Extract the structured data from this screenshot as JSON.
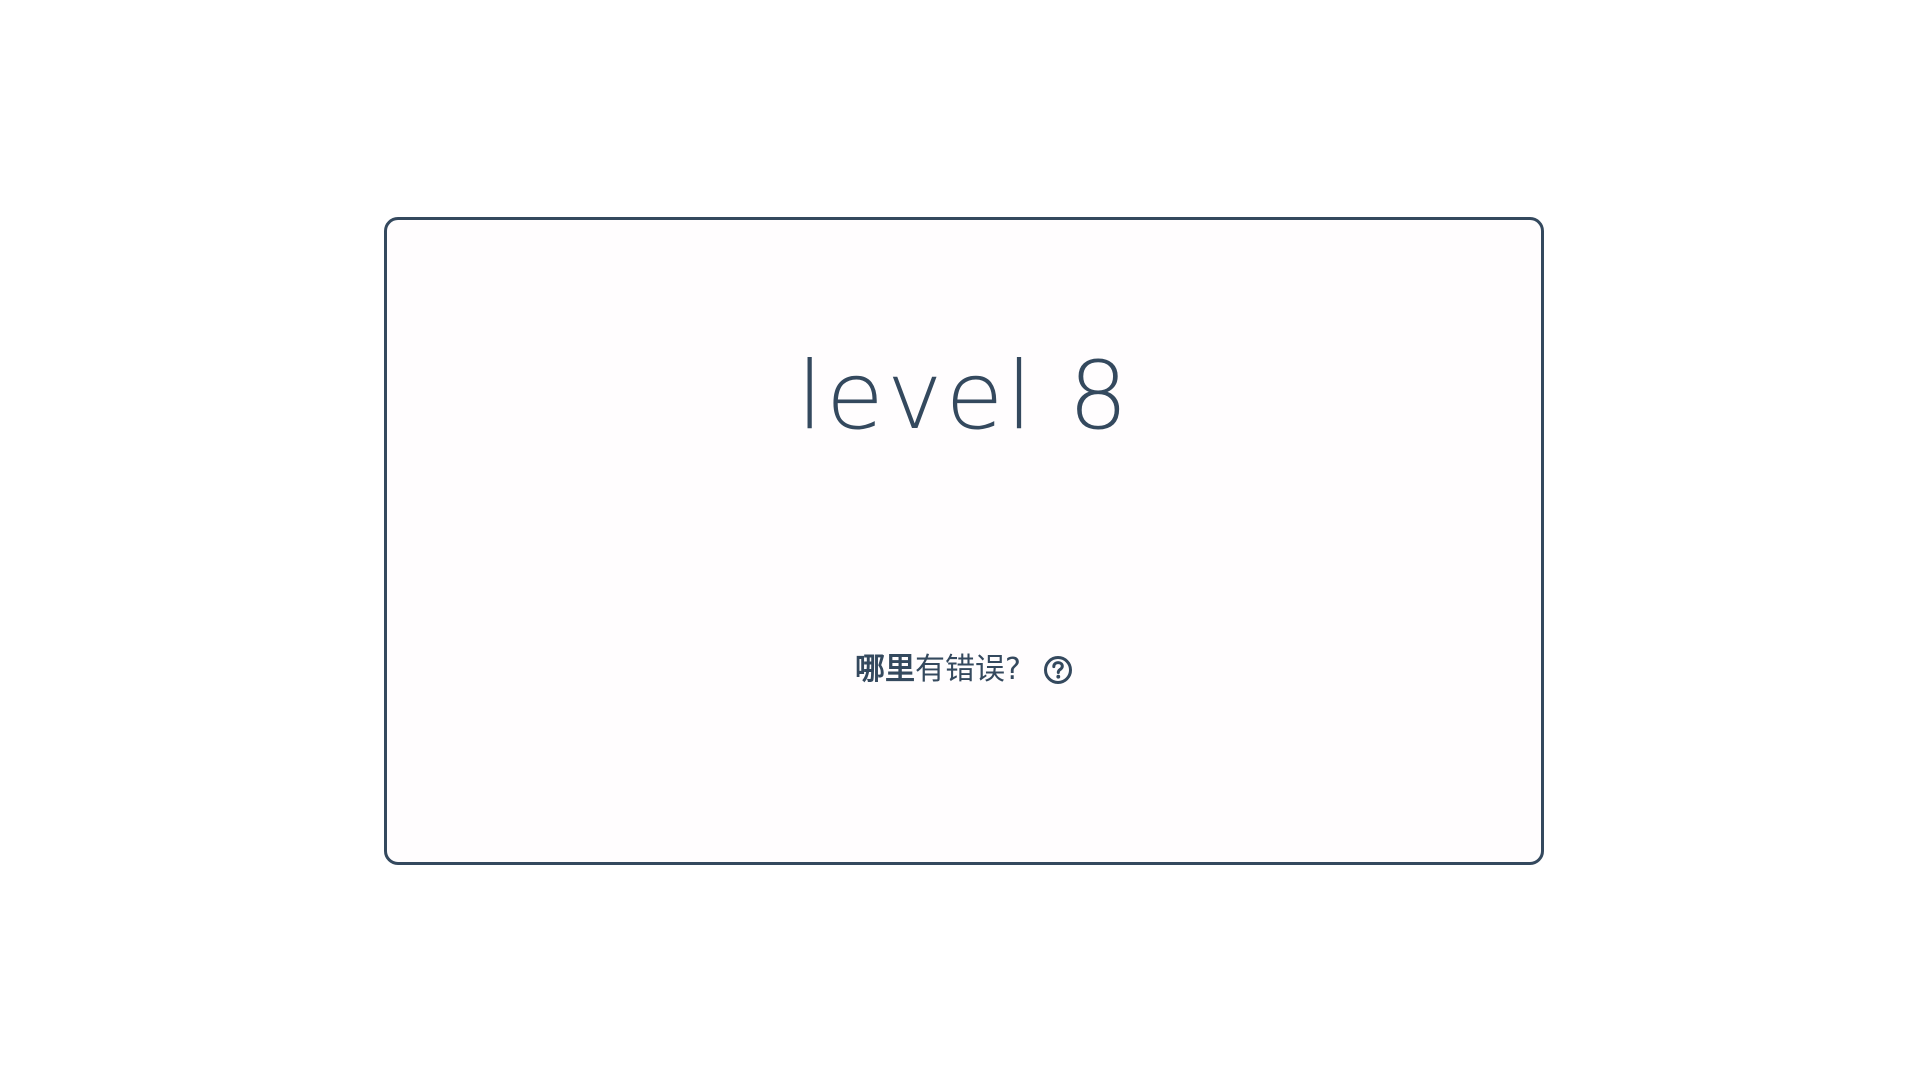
{
  "level": {
    "title": "level 8"
  },
  "question": {
    "strong_text": "哪里",
    "rest_text": "有错误?",
    "help_icon": "question-circle-icon"
  },
  "colors": {
    "text": "#34495e",
    "border": "#34495e",
    "background": "#ffffff",
    "card_background": "#fffdfe"
  }
}
